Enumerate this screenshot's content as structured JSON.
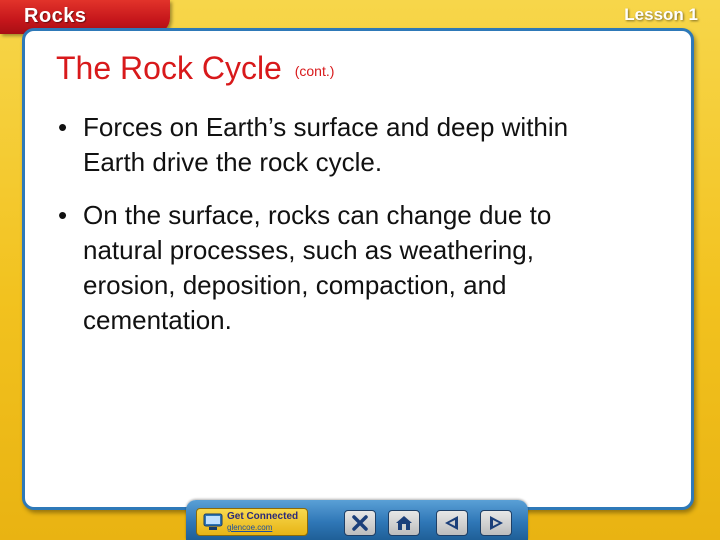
{
  "header": {
    "chapter_tab": "Rocks",
    "lesson_label": "Lesson 1"
  },
  "slide": {
    "title": "The Rock Cycle",
    "title_suffix": "(cont.)",
    "bullets": [
      "Forces on Earth’s surface and deep within Earth drive the rock cycle.",
      "On the surface, rocks can change due to natural processes, such as weathering, erosion, deposition, compaction, and cementation."
    ]
  },
  "nav": {
    "get_connected_label": "Get Connected",
    "get_connected_url": "glencoe.com",
    "buttons": [
      "close-icon",
      "home-icon",
      "previous-icon",
      "next-icon"
    ]
  },
  "colors": {
    "background": "#f2c21f",
    "tab_red": "#c5161b",
    "title_red": "#d8191b",
    "panel_border": "#2e79b8",
    "navbar_blue": "#2f77b7"
  }
}
